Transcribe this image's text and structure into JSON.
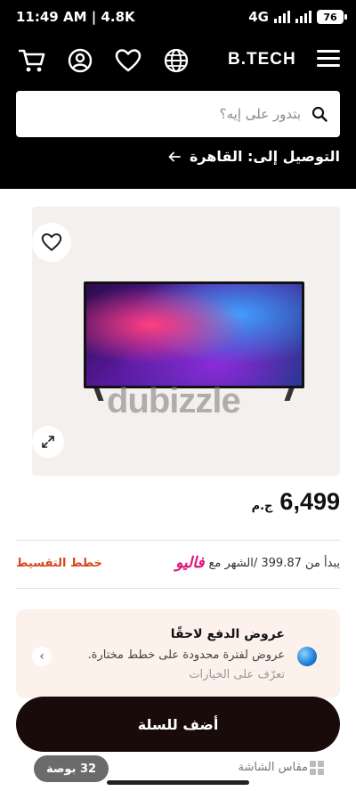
{
  "status_bar": {
    "time_speed": "11:49 AM | 4.8K",
    "network": "4G",
    "battery": "76"
  },
  "header": {
    "logo": "B.TECH",
    "icons": [
      "cart-icon",
      "account-icon",
      "heart-icon",
      "globe-icon",
      "menu-icon"
    ],
    "search_placeholder": "بتدور على إيه؟",
    "delivery_text": "التوصيل إلى: القاهرة"
  },
  "product": {
    "image_watermark": "dubizzle",
    "price_value": "6,499",
    "price_currency": "ج.م"
  },
  "installment": {
    "starts_from": "يبدأ من 399.87 /الشهر مع",
    "provider": "فاليو",
    "plans_link": "خطط التقسيط"
  },
  "offer": {
    "title": "عروض الدفع لاحقًا",
    "description": "عروض لفترة محدودة على خطط مختارة.",
    "more_link": "تعرّف على الخيارات"
  },
  "actions": {
    "add_to_cart": "أضف للسلة"
  },
  "specs": {
    "screen_size_label": "مقاس الشاشة",
    "screen_size_value": "32 بوصة"
  },
  "colors": {
    "header_bg": "#000000",
    "card_bg": "#f3f0ee",
    "installment_link": "#d9471c",
    "valu_brand": "#e0137c",
    "offer_bg": "#fdf1ec",
    "cart_button": "#1a0b0b"
  }
}
